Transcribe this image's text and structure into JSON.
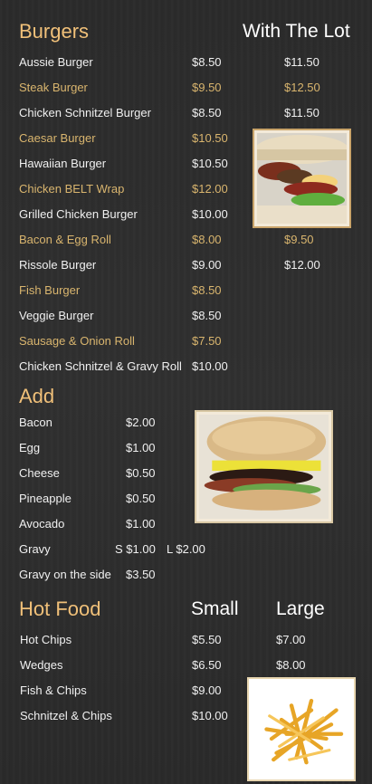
{
  "burgers": {
    "title": "Burgers",
    "col_lot": "With The Lot",
    "items": [
      {
        "name": "Aussie Burger",
        "price": "$8.50",
        "lot": "$11.50"
      },
      {
        "name": "Steak Burger",
        "price": "$9.50",
        "lot": "$12.50"
      },
      {
        "name": "Chicken Schnitzel Burger",
        "price": "$8.50",
        "lot": "$11.50"
      },
      {
        "name": "Caesar Burger",
        "price": "$10.50",
        "lot": ""
      },
      {
        "name": "Hawaiian Burger",
        "price": "$10.50",
        "lot": ""
      },
      {
        "name": "Chicken BELT Wrap",
        "price": "$12.00",
        "lot": ""
      },
      {
        "name": "Grilled Chicken Burger",
        "price": "$10.00",
        "lot": ""
      },
      {
        "name": "Bacon & Egg Roll",
        "price": "$8.00",
        "lot": "$9.50"
      },
      {
        "name": "Rissole Burger",
        "price": "$9.00",
        "lot": "$12.00"
      },
      {
        "name": "Fish Burger",
        "price": "$8.50",
        "lot": ""
      },
      {
        "name": "Veggie Burger",
        "price": "$8.50",
        "lot": ""
      },
      {
        "name": "Sausage & Onion Roll",
        "price": "$7.50",
        "lot": ""
      },
      {
        "name": "Chicken Schnitzel & Gravy Roll",
        "price": "$10.00",
        "lot": ""
      }
    ]
  },
  "add": {
    "title": "Add",
    "items": [
      {
        "name": "Bacon",
        "price": "$2.00"
      },
      {
        "name": "Egg",
        "price": "$1.00"
      },
      {
        "name": "Cheese",
        "price": "$0.50"
      },
      {
        "name": "Pineapple",
        "price": "$0.50"
      },
      {
        "name": "Avocado",
        "price": "$1.00"
      },
      {
        "name": "Gravy",
        "price": "S $1.00",
        "price_large": "L $2.00"
      },
      {
        "name": "Gravy on the side",
        "price": "$3.50"
      }
    ]
  },
  "hot_food": {
    "title": "Hot Food",
    "col_small": "Small",
    "col_large": "Large",
    "items": [
      {
        "name": "Hot Chips",
        "small": "$5.50",
        "large": "$7.00"
      },
      {
        "name": "Wedges",
        "small": "$6.50",
        "large": "$8.00"
      },
      {
        "name": "Fish & Chips",
        "small": "$9.00",
        "large": ""
      },
      {
        "name": "Schnitzel & Chips",
        "small": "$10.00",
        "large": ""
      }
    ]
  },
  "images": [
    "burger-photo-icon",
    "burger-closeup-photo-icon",
    "fries-photo-icon"
  ],
  "colors": {
    "heading": "#f0c079",
    "gold_item": "#d9b56e",
    "text": "#f0f0f0",
    "background": "#2d2d2d"
  }
}
